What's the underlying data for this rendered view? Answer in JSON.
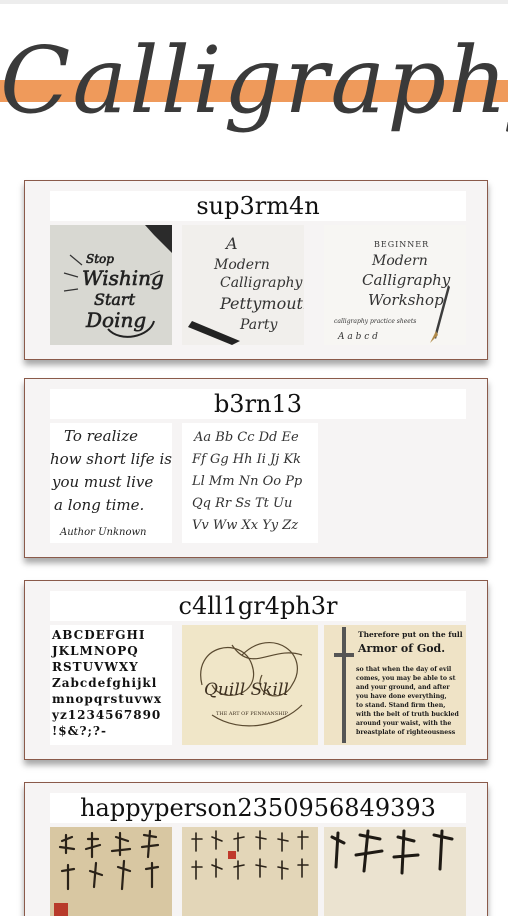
{
  "page": {
    "title": "Calligraphy",
    "accent_color": "#ef9a5b",
    "title_color": "#3a3a3a"
  },
  "cards": [
    {
      "author": "sup3rm4n",
      "images": [
        {
          "name": "stop-wishing-start-doing-lettering",
          "text": "Stop wishing start doing"
        },
        {
          "name": "modern-calligraphy-party-lettering",
          "text": "A modern calligraphy Pettymouth party"
        },
        {
          "name": "beginner-calligraphy-workshop-lettering",
          "text": "Beginner Modern Calligraphy Workshop"
        }
      ]
    },
    {
      "author": "b3rn13",
      "images": [
        {
          "name": "quote-lettering",
          "lines": [
            "To realize",
            "how short life is,",
            "you must live",
            "a long time.",
            "Author Unknown"
          ]
        },
        {
          "name": "script-alphabet",
          "lines": [
            "Aa Bb Cc Dd Ee",
            "Ff Gg Hh Ii Jj Kk",
            "Ll Mm Nn Oo Pp",
            "Qq Rr Ss Tt Uu",
            "Vv Ww Xx Yy Zz"
          ]
        }
      ]
    },
    {
      "author": "c4ll1gr4ph3r",
      "images": [
        {
          "name": "blackletter-alphabet",
          "lines": [
            "ABCDEFGHI",
            "JKLMNOPQ",
            "RSTUVWXY",
            "Zabcdefghijkl",
            "mnopqrstuvwx",
            "yz1234567890",
            "!$&?;?-"
          ]
        },
        {
          "name": "quill-skill-flourish",
          "text": "Quill Skill",
          "subtext": "THE ART OF PENMANSHIP"
        },
        {
          "name": "armor-of-god-blackletter",
          "heading": [
            "Therefore put on the full",
            "Armor of God."
          ],
          "lines": [
            "so that when the day of evil",
            "comes, you may be able to st",
            "and your ground, and after",
            "you have done everything,",
            "to stand. Stand firm then,",
            "with the belt of truth buckled",
            "around your waist, with the",
            "breastplate of righteousness"
          ]
        }
      ]
    },
    {
      "author": "happyperson2350956849393",
      "images": [
        {
          "name": "chinese-calligraphy-scroll-1",
          "text": ""
        },
        {
          "name": "chinese-calligraphy-scroll-2",
          "text": ""
        },
        {
          "name": "chinese-calligraphy-scroll-3",
          "text": ""
        }
      ]
    }
  ]
}
